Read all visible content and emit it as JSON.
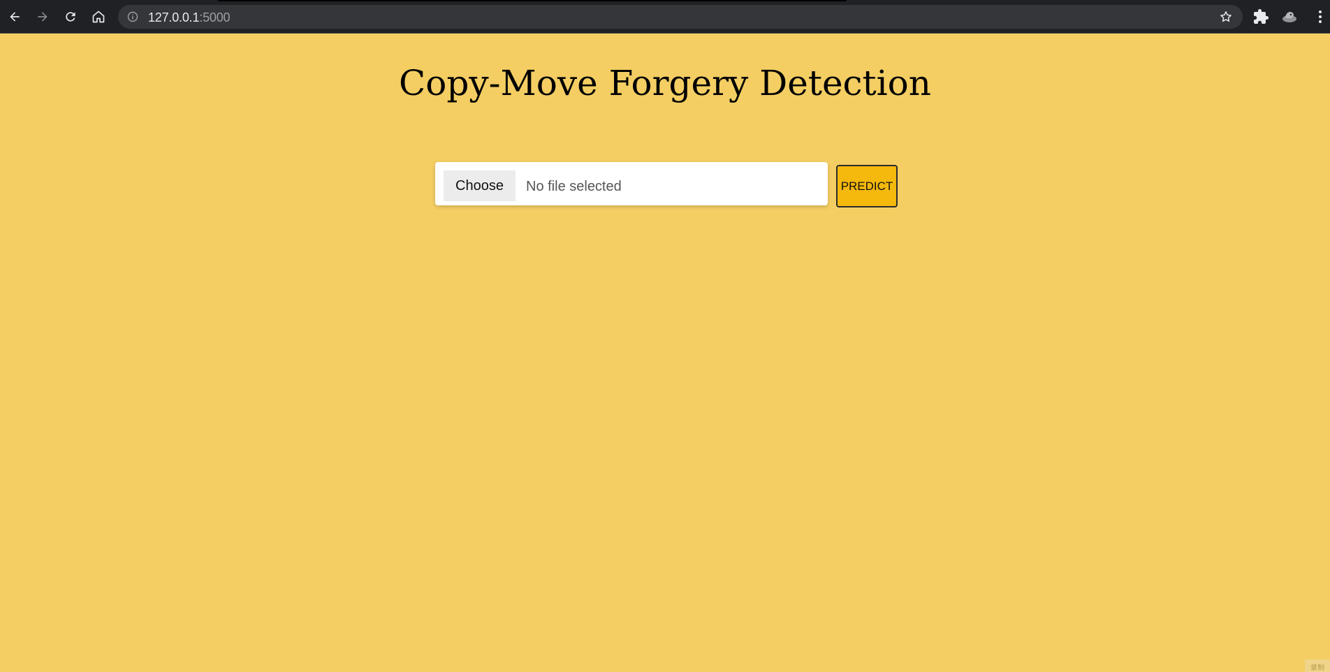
{
  "browser": {
    "url_host": "127.0.0.1",
    "url_port": ":5000",
    "icons": [
      "back-icon",
      "forward-icon",
      "reload-icon",
      "home-icon",
      "info-icon",
      "star-icon",
      "puzzle-icon",
      "profile-icon",
      "menu-icon"
    ]
  },
  "page": {
    "title": "Copy-Move Forgery Detection",
    "background_color": "#f4ce63"
  },
  "upload": {
    "choose_label": "Choose",
    "status_text": "No file selected"
  },
  "predict": {
    "label": "PREDICT",
    "color": "#f5b80c"
  },
  "corner_mark": "录制"
}
